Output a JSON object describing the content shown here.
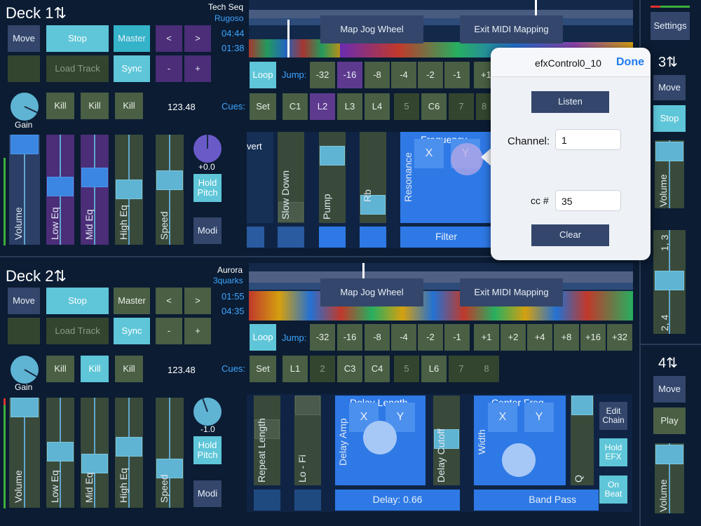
{
  "deck1": {
    "title": "Deck 1",
    "arrow": "⇅",
    "move": "Move",
    "stop": "Stop",
    "master": "Master",
    "prev": "<",
    "next": ">",
    "load": "Load Track",
    "sync": "Sync",
    "minus": "-",
    "plus": "+",
    "kill": "Kill",
    "gain": "Gain",
    "bpm": "123.48",
    "volume": "Volume",
    "loweq": "Low Eq",
    "mideq": "Mid Eq",
    "higheq": "High Eq",
    "speed": "Speed",
    "pitch": "+0.0",
    "hold": "Hold Pitch",
    "modi": "Modi",
    "track": "Tech Seq",
    "artist": "Rugoso",
    "time1": "04:44",
    "time2": "01:38"
  },
  "deck2": {
    "title": "Deck 2",
    "arrow": "⇅",
    "move": "Move",
    "stop": "Stop",
    "master": "Master",
    "prev": "<",
    "next": ">",
    "load": "Load Track",
    "sync": "Sync",
    "minus": "-",
    "plus": "+",
    "kill": "Kill",
    "gain": "Gain",
    "bpm": "123.48",
    "volume": "Volume",
    "loweq": "Low Eq",
    "mideq": "Mid Eq",
    "higheq": "High Eq",
    "speed": "Speed",
    "pitch": "-1.0",
    "hold": "Hold Pitch",
    "modi": "Modi",
    "track": "Aurora",
    "artist": "3quarks",
    "time1": "01:55",
    "time2": "04:35"
  },
  "mapjog": "Map Jog Wheel",
  "exitmidi": "Exit MIDI Mapping",
  "loop": "Loop",
  "jump": "Jump:",
  "cues": "Cues:",
  "set": "Set",
  "jumps1": [
    "-32",
    "-16",
    "-8",
    "-4",
    "-2",
    "-1",
    "+1"
  ],
  "jumps2": [
    "-32",
    "-16",
    "-8",
    "-4",
    "-2",
    "-1",
    "+1",
    "+2",
    "+4",
    "+8",
    "+16",
    "+32"
  ],
  "cues1": [
    "C1",
    "L2",
    "L3",
    "L4",
    "5",
    "C6",
    "7",
    "8"
  ],
  "cues2": [
    "L1",
    "2",
    "C3",
    "C4",
    "5",
    "L6",
    "7",
    "8"
  ],
  "fx1": {
    "invert": "vert",
    "slowdown": "Slow Down",
    "pump": "Pump",
    "rb": "Rb",
    "frequency": "Frequency",
    "resonance": "Resonance",
    "x": "X",
    "y": "Y",
    "filter": "Filter"
  },
  "fx2": {
    "repeat": "Repeat Length",
    "lofi": "Lo - Fi",
    "delaylen": "Delay Length",
    "delayamp": "Delay Amp",
    "delaycutoff": "Delay Cutoff",
    "x": "X",
    "y": "Y",
    "delay": "Delay: 0.66",
    "centerfreq": "Center Freq",
    "width": "Width",
    "q": "Q",
    "bandpass": "Band Pass",
    "editchain": "Edit Chain",
    "holdefx": "Hold EFX",
    "onbeat": "On Beat"
  },
  "popup": {
    "title": "efxControl0_10",
    "done": "Done",
    "listen": "Listen",
    "channel_label": "Channel:",
    "channel": "1",
    "cc_label": "cc #",
    "cc": "35",
    "clear": "Clear"
  },
  "right": {
    "settings": "Settings",
    "deck3": "3",
    "deck4": "4",
    "arrow3": "⇅",
    "arrow4": "⇅",
    "move": "Move",
    "stop": "Stop",
    "play": "Play",
    "volume": "Volume",
    "cross": "1, 3",
    "cross2": "2, 4"
  }
}
